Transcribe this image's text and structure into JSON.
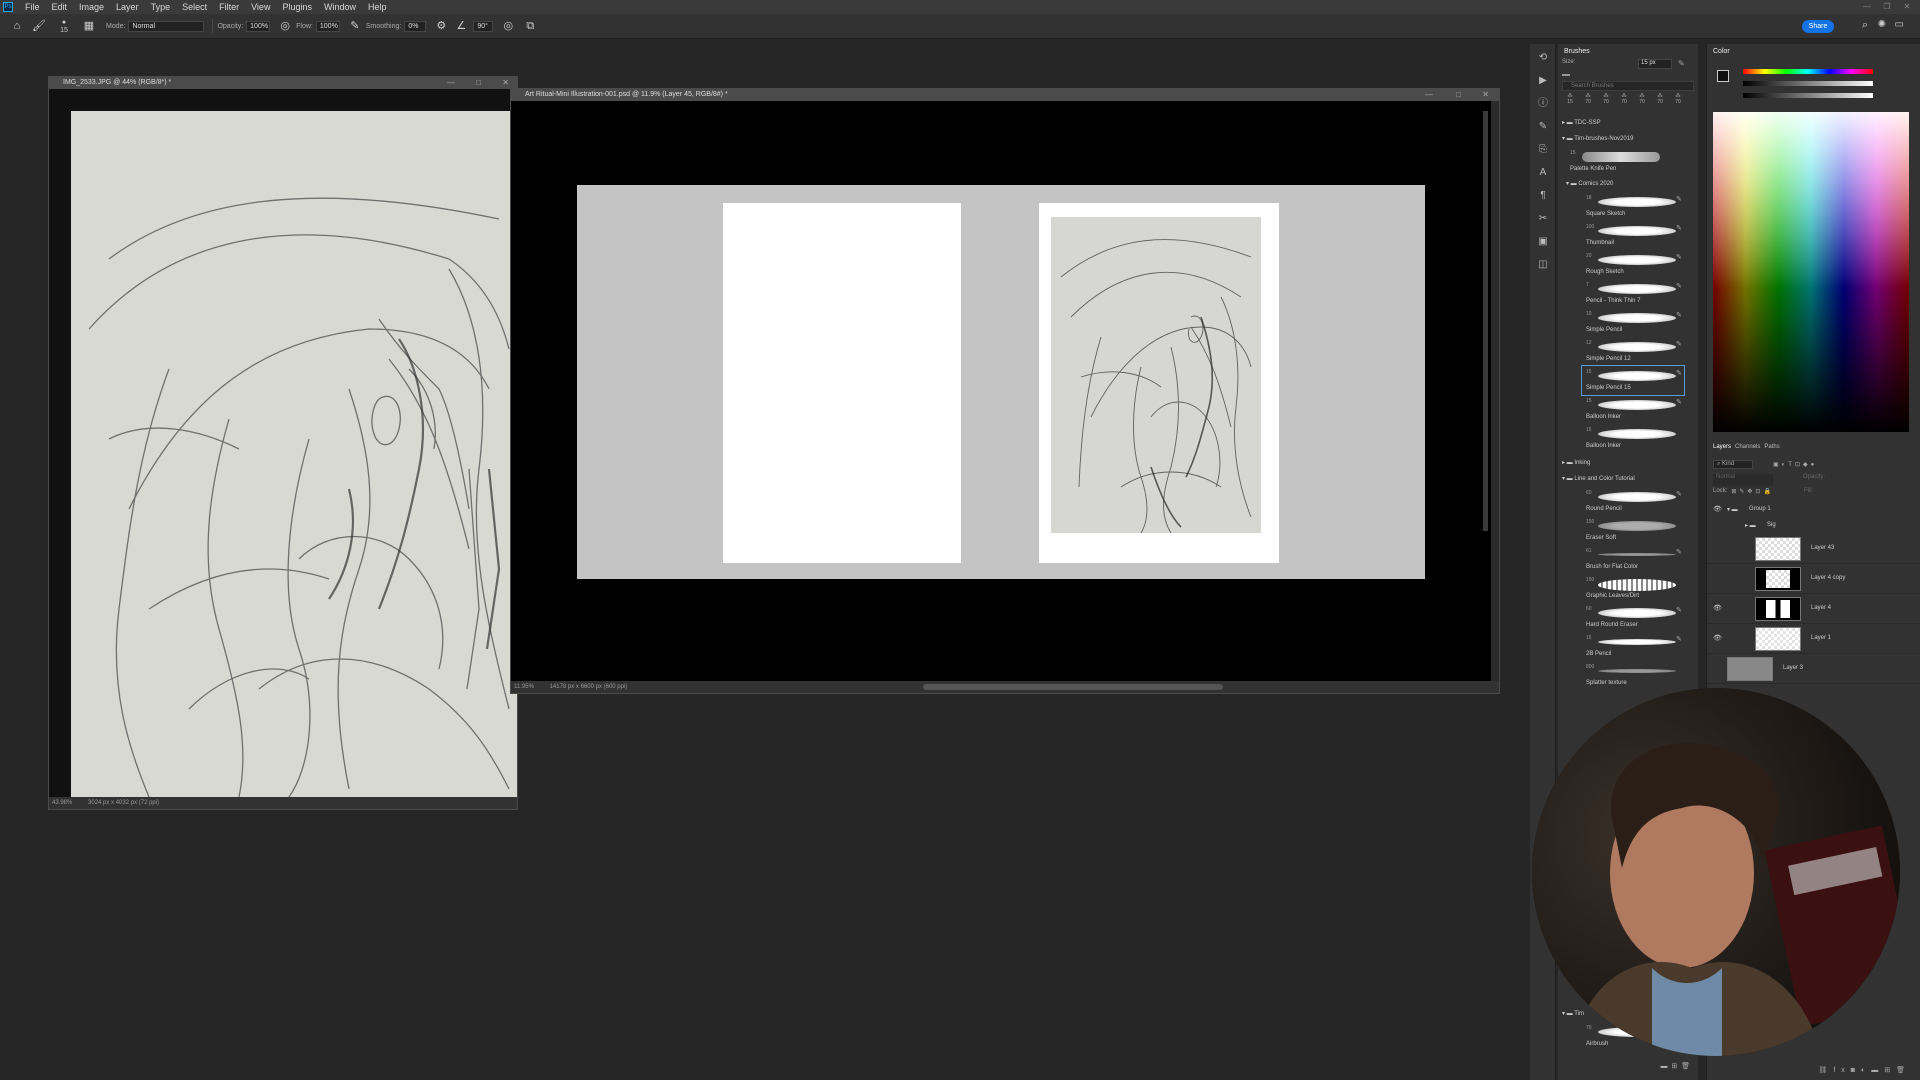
{
  "menubar": {
    "items": [
      "File",
      "Edit",
      "Image",
      "Layer",
      "Type",
      "Select",
      "Filter",
      "View",
      "Plugins",
      "Window",
      "Help"
    ]
  },
  "options": {
    "mode_label": "Mode:",
    "mode_value": "Normal",
    "opacity_label": "Opacity:",
    "opacity_value": "100%",
    "flow_label": "Flow:",
    "flow_value": "100%",
    "smoothing_label": "Smoothing:",
    "smoothing_value": "0%",
    "angle_value": "90°",
    "brush_size_badge": "15",
    "share_label": "Share"
  },
  "doc_ref": {
    "title": "IMG_2533.JPG @ 44% (RGB/8*) *",
    "zoom": "43.98%",
    "info": "3024 px x 4032 px (72 ppi)"
  },
  "doc_main": {
    "title": "Art Ritual-Mini Illustration-001.psd @ 11.9% (Layer 45, RGB/8#) *",
    "zoom": "11.95%",
    "info": "14178 px x 6600 px (600 ppi)"
  },
  "brushes": {
    "tab": "Brushes",
    "size_label": "Size:",
    "size_value": "15 px",
    "search_placeholder": "Search Brushes",
    "preset_sizes": [
      "15",
      "70",
      "70",
      "70",
      "70",
      "70",
      "70"
    ],
    "folders_top": [
      {
        "name": "TDC-SSP"
      },
      {
        "name": "Tim-brushes-Nov2019"
      }
    ],
    "palette_knife": {
      "size": "15",
      "name": "Palette Knife Pen"
    },
    "comics_folder": "Comics 2020",
    "comics_brushes": [
      {
        "size": "18",
        "name": "Square Sketch"
      },
      {
        "size": "100",
        "name": "Thumbnail"
      },
      {
        "size": "20",
        "name": "Rough Sketch"
      },
      {
        "size": "7",
        "name": "Pencil - Think Thin 7"
      },
      {
        "size": "10",
        "name": "Simple Pencil"
      },
      {
        "size": "12",
        "name": "Simple Pencil 12"
      },
      {
        "size": "15",
        "name": "Simple Pencil 15"
      },
      {
        "size": "15",
        "name": "Balloon Inker"
      },
      {
        "size": "15",
        "name": "Balloon Inker"
      }
    ],
    "inking_folder": "Inking",
    "tutorial_folder": "Line and Color Tutorial",
    "tutorial_brushes": [
      {
        "size": "60",
        "name": "Round Pencil"
      },
      {
        "size": "150",
        "name": "Eraser Soft"
      },
      {
        "size": "61",
        "name": "Brush for Flat Color"
      },
      {
        "size": "150",
        "name": "Graphic Leaves/Dirt"
      },
      {
        "size": "60",
        "name": "Hard Round Eraser"
      },
      {
        "size": "15",
        "name": "2B Pencil"
      },
      {
        "size": "800",
        "name": "Splatter texture"
      }
    ],
    "bottom_folder": "Tim",
    "bottom_brush": {
      "size": "70",
      "name": "Airbrush"
    }
  },
  "color": {
    "tab": "Color"
  },
  "layers": {
    "tabs": [
      "Layers",
      "Channels",
      "Paths"
    ],
    "kind_label": "Kind",
    "blend_mode": "Normal",
    "opacity_label": "Opacity:",
    "lock_label": "Lock:",
    "fill_label": "Fill:",
    "items": [
      {
        "name": "Group 1",
        "type": "group",
        "visible": true
      },
      {
        "name": "Sig",
        "type": "group",
        "visible": false
      },
      {
        "name": "Layer 43",
        "type": "layer",
        "visible": false
      },
      {
        "name": "Layer 4 copy",
        "type": "layer",
        "visible": false
      },
      {
        "name": "Layer 4",
        "type": "layer",
        "visible": true
      },
      {
        "name": "Layer 1",
        "type": "layer",
        "visible": true
      },
      {
        "name": "Layer 3",
        "type": "layer",
        "visible": false
      }
    ]
  },
  "colors": {
    "accent": "#1473e6",
    "panel": "#323232",
    "workspace": "#262626"
  }
}
